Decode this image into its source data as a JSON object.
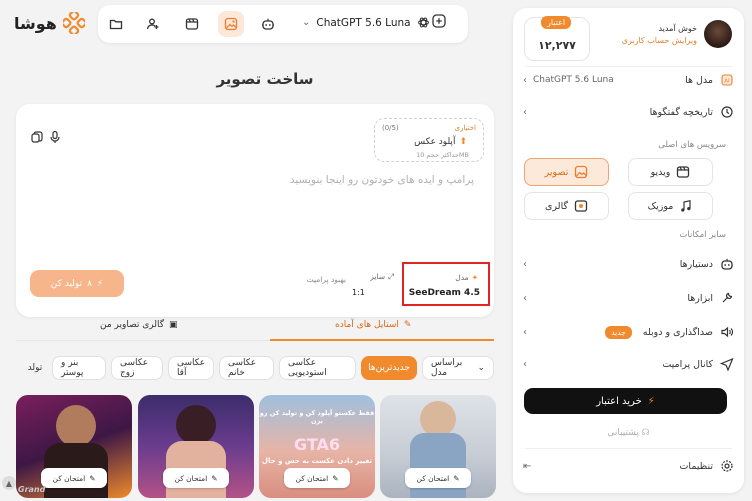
{
  "brand": {
    "name": "هوشا",
    "accent": "#f08a2c"
  },
  "topbar": {
    "model_label": "ChatGPT 5.6 Luna",
    "icons": [
      "folder-icon",
      "add-user-icon",
      "video-icon",
      "image-icon",
      "bot-icon",
      "chevron-down-icon",
      "openai-icon",
      "plus-icon"
    ]
  },
  "panel": {
    "credit_badge": "اعتبار",
    "credit_value": "۱۲,۲۷۷",
    "user_hello": "خوش آمدید",
    "user_edit": "ویرایش حساب کاربری",
    "models_label": "مدل ها",
    "models_current": "ChatGPT 5.6 Luna",
    "history_label": "تاریخچه گفتگوها",
    "main_services": "سرویس های اصلی",
    "services": [
      "ویدیو",
      "تصویر",
      "موزیک",
      "گالری"
    ],
    "other_section": "سایر امکانات",
    "assistants": "دستیارها",
    "tools": "ابزارها",
    "voice": "صداگذاری و دوبله",
    "new_badge": "جدید",
    "prompt_channel": "کانال پرامپت",
    "buy": "خرید اعتبار",
    "support": "پشتیبانی",
    "settings": "تنظیمات"
  },
  "main": {
    "title": "ساخت تصویر",
    "upload_optional": "اختیاری",
    "upload_count": "(0/5)",
    "upload_title": "آپلود عکس",
    "upload_max": "حداکثر حجم 10MB",
    "prompt_placeholder": "پرامپ و ایده های خودتون رو اینجا بنویسید",
    "model_label": "مدل",
    "model_value": "SeeDream 4.5",
    "size_label": "سایز",
    "size_value": "1:1",
    "improve_label": "بهبود پرامپت",
    "generate_label": "تولید کن",
    "generate_cost": "۸"
  },
  "tabs": {
    "ready_styles": "استایل های آماده",
    "my_gallery": "گالری تصاویر من"
  },
  "filters": [
    "براساس مدل",
    "جدیدترین‌ها",
    "عکاسی استودیویی",
    "عکاسی خانم",
    "عکاسی آقا",
    "عکاسی زوج",
    "بنر و پوستر",
    "تولد"
  ],
  "gallery": {
    "try_label": "امتحان کن",
    "poster_line1": "فقط عکستو آپلود کن و تولید کن رو بزن",
    "poster_line2": "GTA6",
    "poster_line3": "تغییر دادن عکست به حس و حال",
    "watermark": "Grand"
  }
}
